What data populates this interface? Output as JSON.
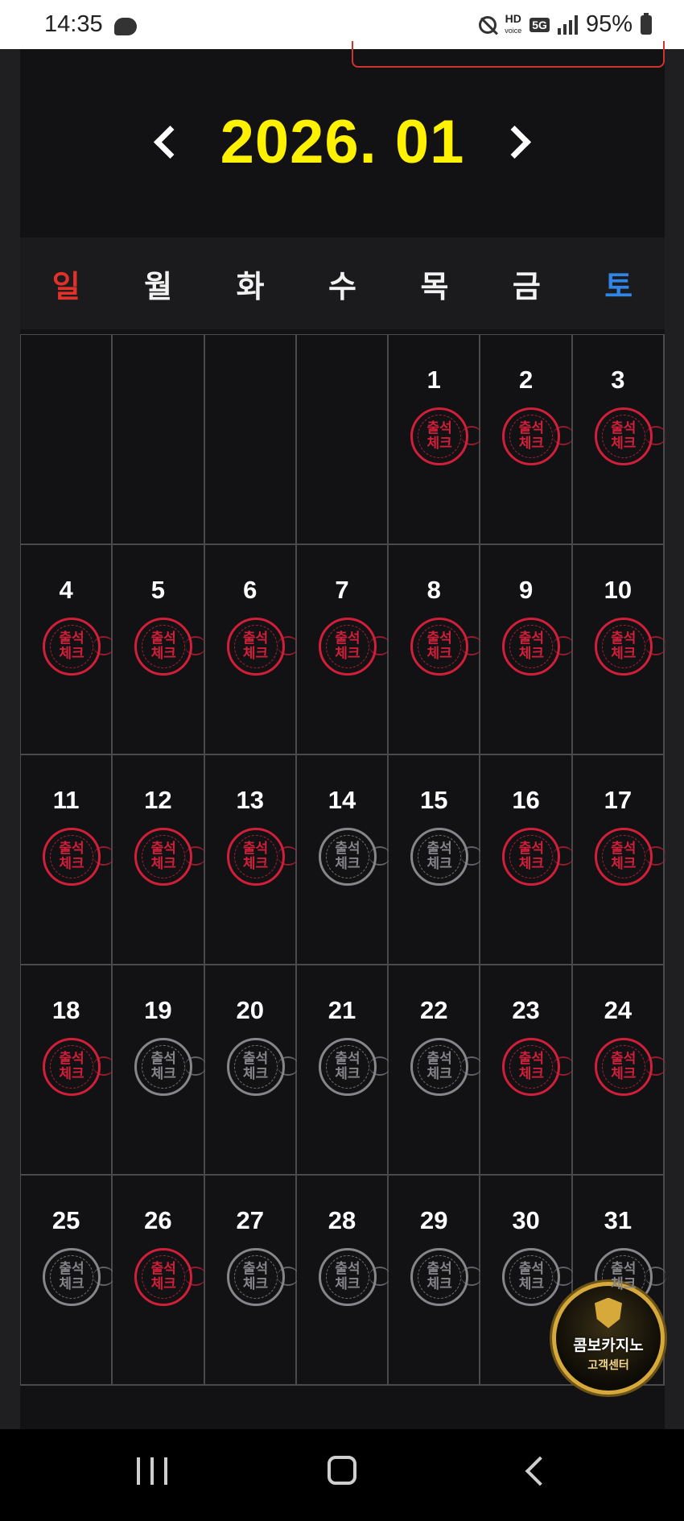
{
  "status_bar": {
    "time": "14:35",
    "hd_label": "HD",
    "voice_label": "voice",
    "net_label": "5G",
    "battery": "95%"
  },
  "calendar": {
    "month_label": "2026. 01",
    "weekdays": [
      "일",
      "월",
      "화",
      "수",
      "목",
      "금",
      "토"
    ],
    "stamp_text_top": "출석",
    "stamp_text_bottom": "체크",
    "stamp_colors": {
      "checked": "#d11f3a",
      "unchecked": "#85858a"
    },
    "cells": [
      {
        "day": ""
      },
      {
        "day": ""
      },
      {
        "day": ""
      },
      {
        "day": ""
      },
      {
        "day": "1",
        "checked": true
      },
      {
        "day": "2",
        "checked": true
      },
      {
        "day": "3",
        "checked": true
      },
      {
        "day": "4",
        "checked": true
      },
      {
        "day": "5",
        "checked": true
      },
      {
        "day": "6",
        "checked": true
      },
      {
        "day": "7",
        "checked": true
      },
      {
        "day": "8",
        "checked": true
      },
      {
        "day": "9",
        "checked": true
      },
      {
        "day": "10",
        "checked": true
      },
      {
        "day": "11",
        "checked": true
      },
      {
        "day": "12",
        "checked": true
      },
      {
        "day": "13",
        "checked": true
      },
      {
        "day": "14",
        "checked": false
      },
      {
        "day": "15",
        "checked": false
      },
      {
        "day": "16",
        "checked": true
      },
      {
        "day": "17",
        "checked": true
      },
      {
        "day": "18",
        "checked": true
      },
      {
        "day": "19",
        "checked": false
      },
      {
        "day": "20",
        "checked": false
      },
      {
        "day": "21",
        "checked": false
      },
      {
        "day": "22",
        "checked": false
      },
      {
        "day": "23",
        "checked": true
      },
      {
        "day": "24",
        "checked": true
      },
      {
        "day": "25",
        "checked": false
      },
      {
        "day": "26",
        "checked": true
      },
      {
        "day": "27",
        "checked": false
      },
      {
        "day": "28",
        "checked": false
      },
      {
        "day": "29",
        "checked": false
      },
      {
        "day": "30",
        "checked": false
      },
      {
        "day": "31",
        "checked": false
      }
    ]
  },
  "support_badge": {
    "title": "콤보카지노",
    "subtitle": "고객센터"
  }
}
